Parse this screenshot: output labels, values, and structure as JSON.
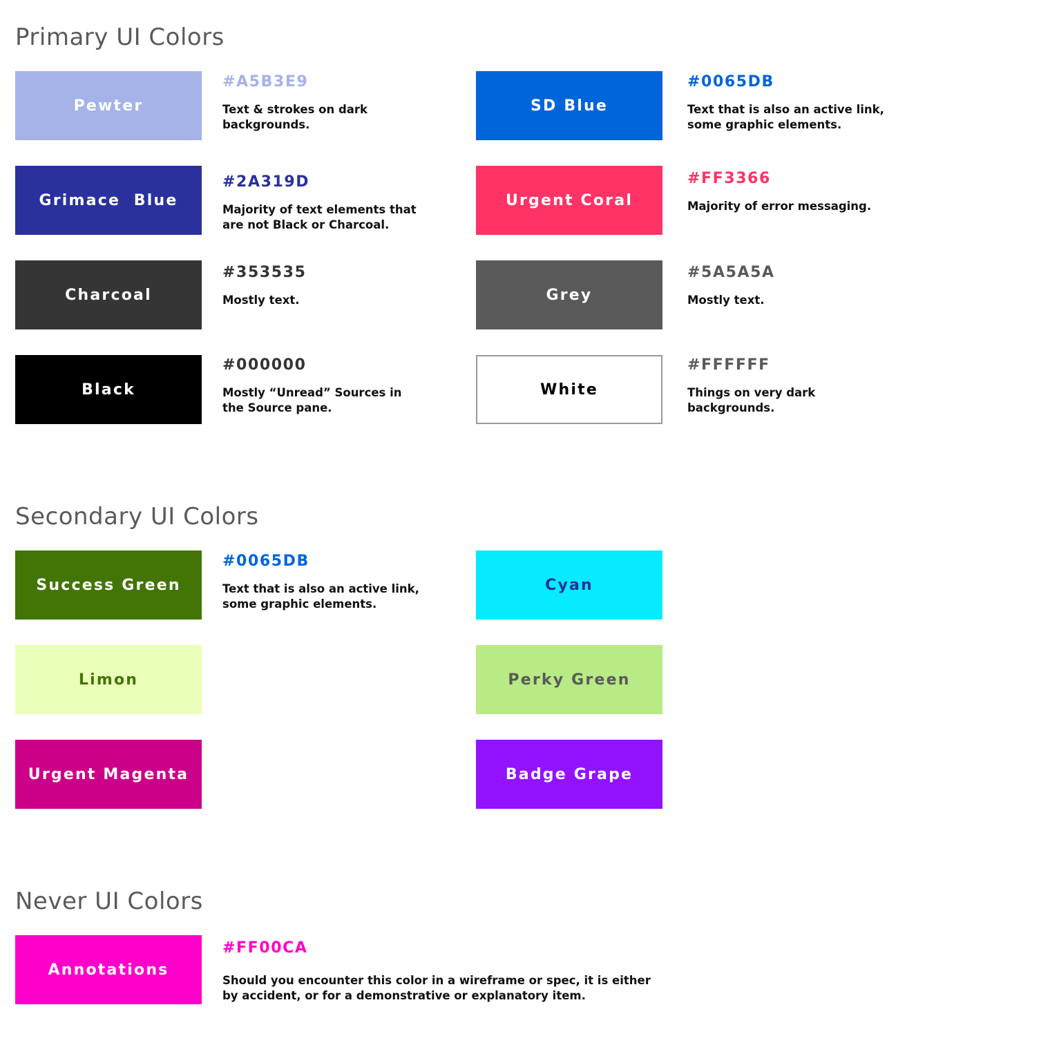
{
  "sections": {
    "primary": {
      "title": "Primary UI Colors",
      "items": [
        {
          "name": "Pewter",
          "swatch_color": "#A5B3E9",
          "label_color": "#FFFFFF",
          "hex": "#A5B3E9",
          "hex_color": "#A5B3E9",
          "description": [
            "Text & strokes on dark",
            "backgrounds."
          ]
        },
        {
          "name": "SD Blue",
          "swatch_color": "#0065DB",
          "label_color": "#FFFFFF",
          "hex": "#0065DB",
          "hex_color": "#0065DB",
          "description": [
            "Text that is also an active link,",
            "some graphic elements."
          ]
        },
        {
          "name": "Grimace  Blue",
          "swatch_color": "#2A319D",
          "label_color": "#FFFFFF",
          "hex": "#2A319D",
          "hex_color": "#2A319D",
          "description": [
            "Majority of text elements that",
            "are not Black or Charcoal."
          ]
        },
        {
          "name": "Urgent Coral",
          "swatch_color": "#FF3366",
          "label_color": "#FFFFFF",
          "hex": "#FF3366",
          "hex_color": "#FF3366",
          "description": [
            "Majority of error messaging."
          ]
        },
        {
          "name": "Charcoal",
          "swatch_color": "#353535",
          "label_color": "#FFFFFF",
          "hex": "#353535",
          "hex_color": "#353535",
          "description": [
            "Mostly text."
          ]
        },
        {
          "name": "Grey",
          "swatch_color": "#5A5A5A",
          "label_color": "#FFFFFF",
          "hex": "#5A5A5A",
          "hex_color": "#5A5A5A",
          "description": [
            "Mostly text."
          ]
        },
        {
          "name": "Black",
          "swatch_color": "#000000",
          "label_color": "#FFFFFF",
          "hex": "#000000",
          "hex_color": "#353535",
          "description": [
            "Mostly “Unread” Sources in",
            "the Source pane."
          ]
        },
        {
          "name": "White",
          "swatch_color": "#FFFFFF",
          "label_color": "#000000",
          "border_color": "#9A9A9A",
          "hex": "#FFFFFF",
          "hex_color": "#5A5A5A",
          "description": [
            "Things on very dark",
            "backgrounds."
          ]
        }
      ]
    },
    "secondary": {
      "title": "Secondary UI Colors",
      "items": [
        {
          "name": "Success Green",
          "swatch_color": "#427505",
          "label_color": "#FFFFFF",
          "hex": "#0065DB",
          "hex_color": "#0065DB",
          "description": [
            "Text that is also an active link,",
            "some graphic elements."
          ]
        },
        {
          "name": "Cyan",
          "swatch_color": "#06EBFF",
          "label_color": "#2A319D"
        },
        {
          "name": "Limon",
          "swatch_color": "#EAFFB9",
          "label_color": "#427505"
        },
        {
          "name": "Perky Green",
          "swatch_color": "#B8EA85",
          "label_color": "#5A5A5A"
        },
        {
          "name": "Urgent Magenta",
          "swatch_color": "#CC0088",
          "label_color": "#FFFFFF"
        },
        {
          "name": "Badge Grape",
          "swatch_color": "#9312FF",
          "label_color": "#FFFFFF"
        }
      ]
    },
    "never": {
      "title": "Never UI Colors",
      "items": [
        {
          "name": "Annotations",
          "swatch_color": "#FF00CA",
          "label_color": "#FFFFFF",
          "hex": "#FF00CA",
          "hex_color": "#FF00CA",
          "description": [
            "Should you encounter this color in a wireframe or spec, it is either",
            "by accident, or for a demonstrative or explanatory item."
          ]
        }
      ]
    }
  }
}
